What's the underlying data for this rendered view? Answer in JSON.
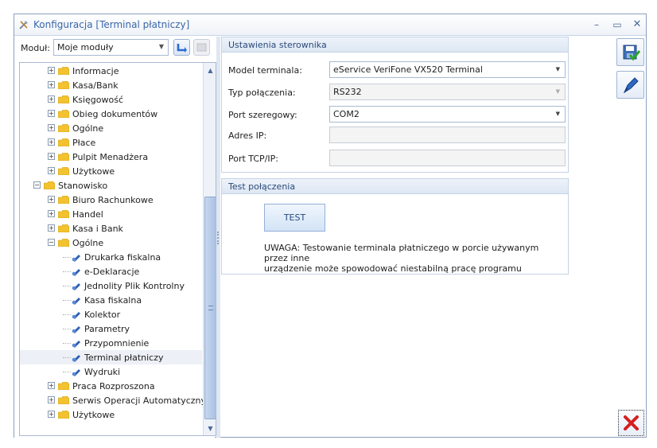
{
  "window": {
    "title": "Konfiguracja [Terminal płatniczy]",
    "controls": {
      "minimize": "–",
      "maximize": "▭",
      "close": "✕"
    }
  },
  "left": {
    "modul_label": "Moduł:",
    "modul_value": "Moje moduły",
    "tree": [
      {
        "label": "Informacje",
        "level": 1,
        "type": "folder",
        "expander": "+"
      },
      {
        "label": "Kasa/Bank",
        "level": 1,
        "type": "folder",
        "expander": "+"
      },
      {
        "label": "Księgowość",
        "level": 1,
        "type": "folder",
        "expander": "+"
      },
      {
        "label": "Obieg dokumentów",
        "level": 1,
        "type": "folder",
        "expander": "+"
      },
      {
        "label": "Ogólne",
        "level": 1,
        "type": "folder",
        "expander": "+"
      },
      {
        "label": "Płace",
        "level": 1,
        "type": "folder",
        "expander": "+"
      },
      {
        "label": "Pulpit Menadżera",
        "level": 1,
        "type": "folder",
        "expander": "+"
      },
      {
        "label": "Użytkowe",
        "level": 1,
        "type": "folder",
        "expander": "+"
      },
      {
        "label": "Stanowisko",
        "level": 0,
        "type": "folder",
        "expander": "−"
      },
      {
        "label": "Biuro Rachunkowe",
        "level": 1,
        "type": "folder",
        "expander": "+"
      },
      {
        "label": "Handel",
        "level": 1,
        "type": "folder",
        "expander": "+"
      },
      {
        "label": "Kasa i Bank",
        "level": 1,
        "type": "folder",
        "expander": "+"
      },
      {
        "label": "Ogólne",
        "level": 1,
        "type": "folder",
        "expander": "−"
      },
      {
        "label": "Drukarka fiskalna",
        "level": 2,
        "type": "leaf"
      },
      {
        "label": "e-Deklaracje",
        "level": 2,
        "type": "leaf"
      },
      {
        "label": "Jednolity Plik Kontrolny",
        "level": 2,
        "type": "leaf"
      },
      {
        "label": "Kasa fiskalna",
        "level": 2,
        "type": "leaf"
      },
      {
        "label": "Kolektor",
        "level": 2,
        "type": "leaf"
      },
      {
        "label": "Parametry",
        "level": 2,
        "type": "leaf"
      },
      {
        "label": "Przypomnienie",
        "level": 2,
        "type": "leaf"
      },
      {
        "label": "Terminal płatniczy",
        "level": 2,
        "type": "leaf",
        "selected": true
      },
      {
        "label": "Wydruki",
        "level": 2,
        "type": "leaf"
      },
      {
        "label": "Praca Rozproszona",
        "level": 1,
        "type": "folder",
        "expander": "+"
      },
      {
        "label": "Serwis Operacji Automatycznych",
        "level": 1,
        "type": "folder",
        "expander": "+"
      },
      {
        "label": "Użytkowe",
        "level": 1,
        "type": "folder",
        "expander": "+"
      }
    ]
  },
  "settings": {
    "header": "Ustawienia sterownika",
    "model_label": "Model terminala:",
    "model_value": "eService VeriFone VX520 Terminal",
    "conn_label": "Typ połączenia:",
    "conn_value": "RS232",
    "port_label": "Port szeregowy:",
    "port_value": "COM2",
    "ip_label": "Adres IP:",
    "ip_value": "",
    "tcp_label": "Port TCP/IP:",
    "tcp_value": ""
  },
  "test": {
    "header": "Test połączenia",
    "button": "TEST",
    "warning_line1": "UWAGA: Testowanie terminala płatniczego w porcie używanym przez inne",
    "warning_line2": "urządzenie może spowodować niestabilną pracę programu"
  },
  "colors": {
    "accent": "#3a66a8",
    "folder": "#f2c230",
    "close_red": "#d42020"
  }
}
